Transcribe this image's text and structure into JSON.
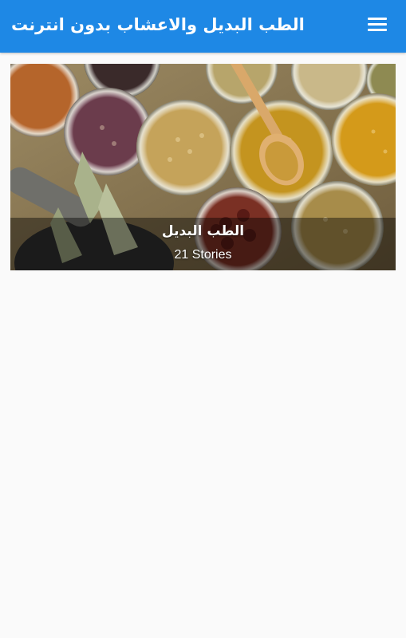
{
  "appbar": {
    "title": "الطب البديل والاعشاب بدون انترنت",
    "menu_icon": "hamburger-menu-icon",
    "color": "#1e88e5"
  },
  "card": {
    "title": "الطب البديل",
    "subtitle": "21 Stories",
    "image": "herbs-and-spices-jars-photo"
  },
  "page": {
    "background": "#fafafa"
  }
}
